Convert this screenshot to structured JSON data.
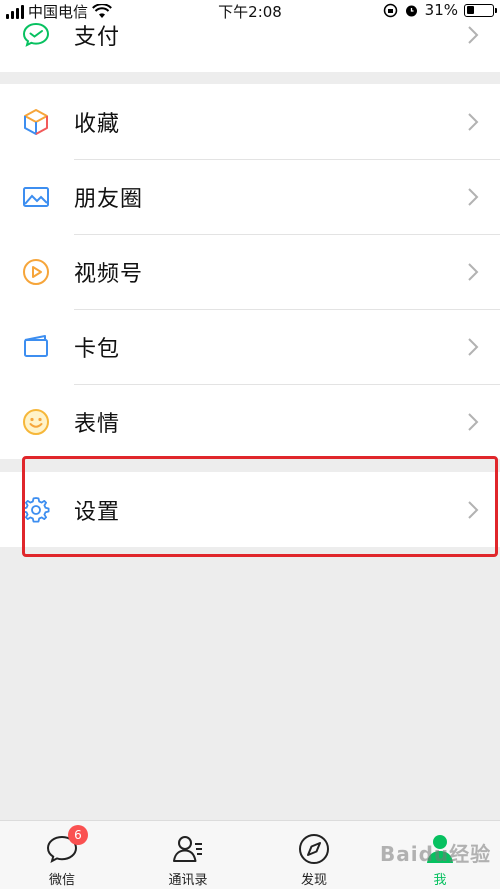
{
  "status_bar": {
    "carrier": "中国电信",
    "time": "下午2:08",
    "battery": "31%",
    "battery_level": 0.31
  },
  "menu": {
    "pay": {
      "label": "支付",
      "icon": "wechat-pay-icon"
    },
    "items": [
      {
        "label": "收藏",
        "icon": "favorites-cube-icon"
      },
      {
        "label": "朋友圈",
        "icon": "moments-photo-icon"
      },
      {
        "label": "视频号",
        "icon": "channels-play-icon"
      },
      {
        "label": "卡包",
        "icon": "card-wallet-icon"
      },
      {
        "label": "表情",
        "icon": "sticker-smile-icon"
      }
    ],
    "settings": {
      "label": "设置",
      "icon": "gear-icon"
    }
  },
  "tabbar": {
    "tabs": [
      {
        "label": "微信",
        "icon": "chat-bubble-icon",
        "badge": "6"
      },
      {
        "label": "通讯录",
        "icon": "contacts-icon"
      },
      {
        "label": "发现",
        "icon": "compass-icon"
      },
      {
        "label": "我",
        "icon": "me-person-icon",
        "active": true
      }
    ]
  },
  "colors": {
    "accent_green": "#07c160",
    "badge_red": "#fa5151",
    "highlight_red": "#e0262b"
  },
  "watermark": "Baidu经验"
}
